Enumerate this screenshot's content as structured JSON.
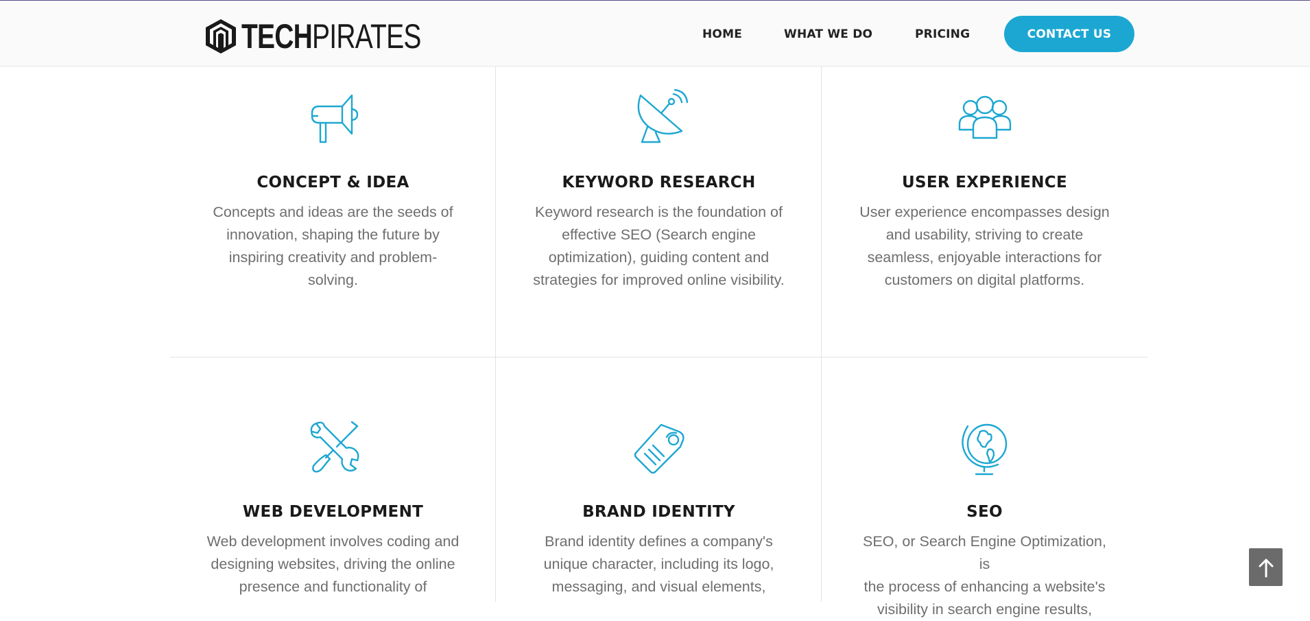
{
  "header": {
    "logo": {
      "text_bold": "TECH",
      "text_light": "PIRATES",
      "icon": "striped-shield-logo-icon"
    },
    "nav": [
      "HOME",
      "WHAT WE DO",
      "PRICING"
    ],
    "cta": "CONTACT US"
  },
  "colors": {
    "accent": "#1ca7d2",
    "heading": "#1a1a1a",
    "body_text": "#6e6e6e",
    "divider": "#e3e3e3"
  },
  "services": [
    {
      "icon": "megaphone-icon",
      "title": "CONCEPT & IDEA",
      "lines": [
        "Concepts and ideas are the seeds of",
        "innovation, shaping the future by",
        "inspiring creativity and problem-",
        "solving."
      ]
    },
    {
      "icon": "satellite-dish-icon",
      "title": "KEYWORD RESEARCH",
      "lines": [
        "Keyword research is the foundation of",
        "effective SEO (Search engine",
        "optimization), guiding content and",
        "strategies for improved online visibility."
      ]
    },
    {
      "icon": "users-group-icon",
      "title": "USER EXPERIENCE",
      "lines": [
        "User experience encompasses design",
        "and usability, striving to create",
        "seamless, enjoyable interactions for",
        "customers on digital platforms."
      ]
    },
    {
      "icon": "wrench-screwdriver-icon",
      "title": "WEB DEVELOPMENT",
      "lines": [
        "Web development involves coding and",
        "designing websites, driving the online",
        "presence and functionality of"
      ]
    },
    {
      "icon": "price-tag-icon",
      "title": "BRAND IDENTITY",
      "lines": [
        "Brand identity defines a company's",
        "unique character, including its logo,",
        "messaging, and visual elements,"
      ]
    },
    {
      "icon": "globe-icon",
      "title": "SEO",
      "lines": [
        "SEO, or Search Engine Optimization, is",
        "the process of enhancing a website's",
        "visibility in search engine results,"
      ]
    }
  ],
  "scroll_top": {
    "icon": "arrow-up-icon"
  }
}
